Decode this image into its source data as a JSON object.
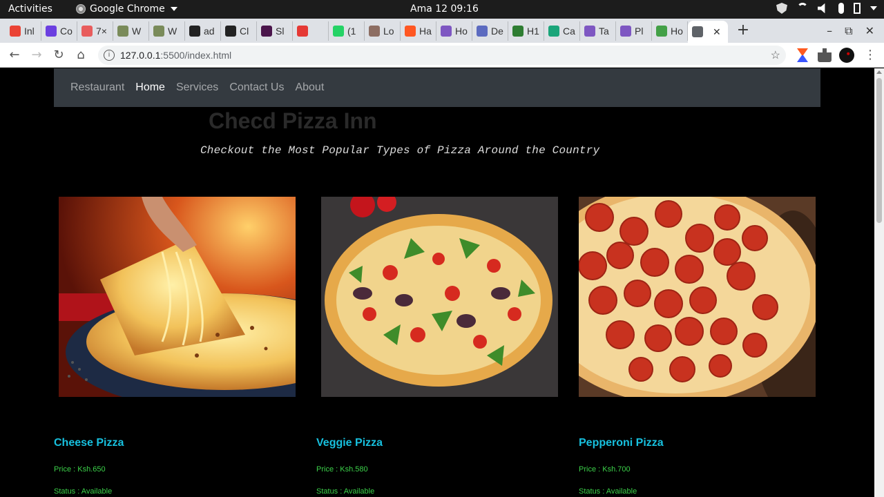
{
  "os_bar": {
    "activities": "Activities",
    "app_name": "Google Chrome",
    "clock": "Ama 12  09:16"
  },
  "tabs": [
    {
      "label": "Inl",
      "icon": "gmail-icon",
      "color": "#ea4335"
    },
    {
      "label": "Co",
      "icon": "c-circle-icon",
      "color": "#6b3fe0"
    },
    {
      "label": "7×",
      "icon": "swirl-icon",
      "color": "#e85d5d"
    },
    {
      "label": "W",
      "icon": "palm-icon",
      "color": "#7a8b5a"
    },
    {
      "label": "W",
      "icon": "palm-icon",
      "color": "#7a8b5a"
    },
    {
      "label": "ad",
      "icon": "github-icon",
      "color": "#222222"
    },
    {
      "label": "Cl",
      "icon": "github-icon",
      "color": "#222222"
    },
    {
      "label": "Sl",
      "icon": "slack-icon",
      "color": "#4a154b"
    },
    {
      "label": "",
      "icon": "record-icon",
      "color": "#e53935"
    },
    {
      "label": "(1",
      "icon": "whatsapp-icon",
      "color": "#25d366"
    },
    {
      "label": "Lo",
      "icon": "bowl-icon",
      "color": "#8d6e63"
    },
    {
      "label": "Ha",
      "icon": "blogger-icon",
      "color": "#ff5722"
    },
    {
      "label": "Ho",
      "icon": "docs-icon",
      "color": "#7e57c2"
    },
    {
      "label": "De",
      "icon": "cap-icon",
      "color": "#5c6bc0"
    },
    {
      "label": "H1",
      "icon": "diamond-icon",
      "color": "#2e7d32"
    },
    {
      "label": "Ca",
      "icon": "ez-icon",
      "color": "#1aa57a"
    },
    {
      "label": "Ta",
      "icon": "docs-icon",
      "color": "#7e57c2"
    },
    {
      "label": "Pl",
      "icon": "docs-icon",
      "color": "#7e57c2"
    },
    {
      "label": "Ho",
      "icon": "green-icon",
      "color": "#43a047"
    },
    {
      "label": "",
      "icon": "globe-icon",
      "color": "#5f6368"
    }
  ],
  "address_bar": {
    "url_host": "127.0.0.1",
    "url_rest": ":5500/index.html"
  },
  "page": {
    "navbar": {
      "brand": "Restaurant",
      "links": [
        "Home",
        "Services",
        "Contact Us",
        "About"
      ],
      "active_link": "Home"
    },
    "title": "Checd Pizza Inn",
    "tagline": "Checkout the Most Popular Types of Pizza Around the Country",
    "pizzas": [
      {
        "name": "Cheese Pizza",
        "price": "Price : Ksh.650",
        "status": "Status : Available"
      },
      {
        "name": "Veggie Pizza",
        "price": "Price : Ksh.580",
        "status": "Status : Available"
      },
      {
        "name": "Pepperoni Pizza",
        "price": "Price : Ksh.700",
        "status": "Status : Available"
      }
    ]
  },
  "colors": {
    "navbar_bg": "#343a40",
    "card_title": "#17c0de",
    "card_text": "#3cd24a"
  }
}
